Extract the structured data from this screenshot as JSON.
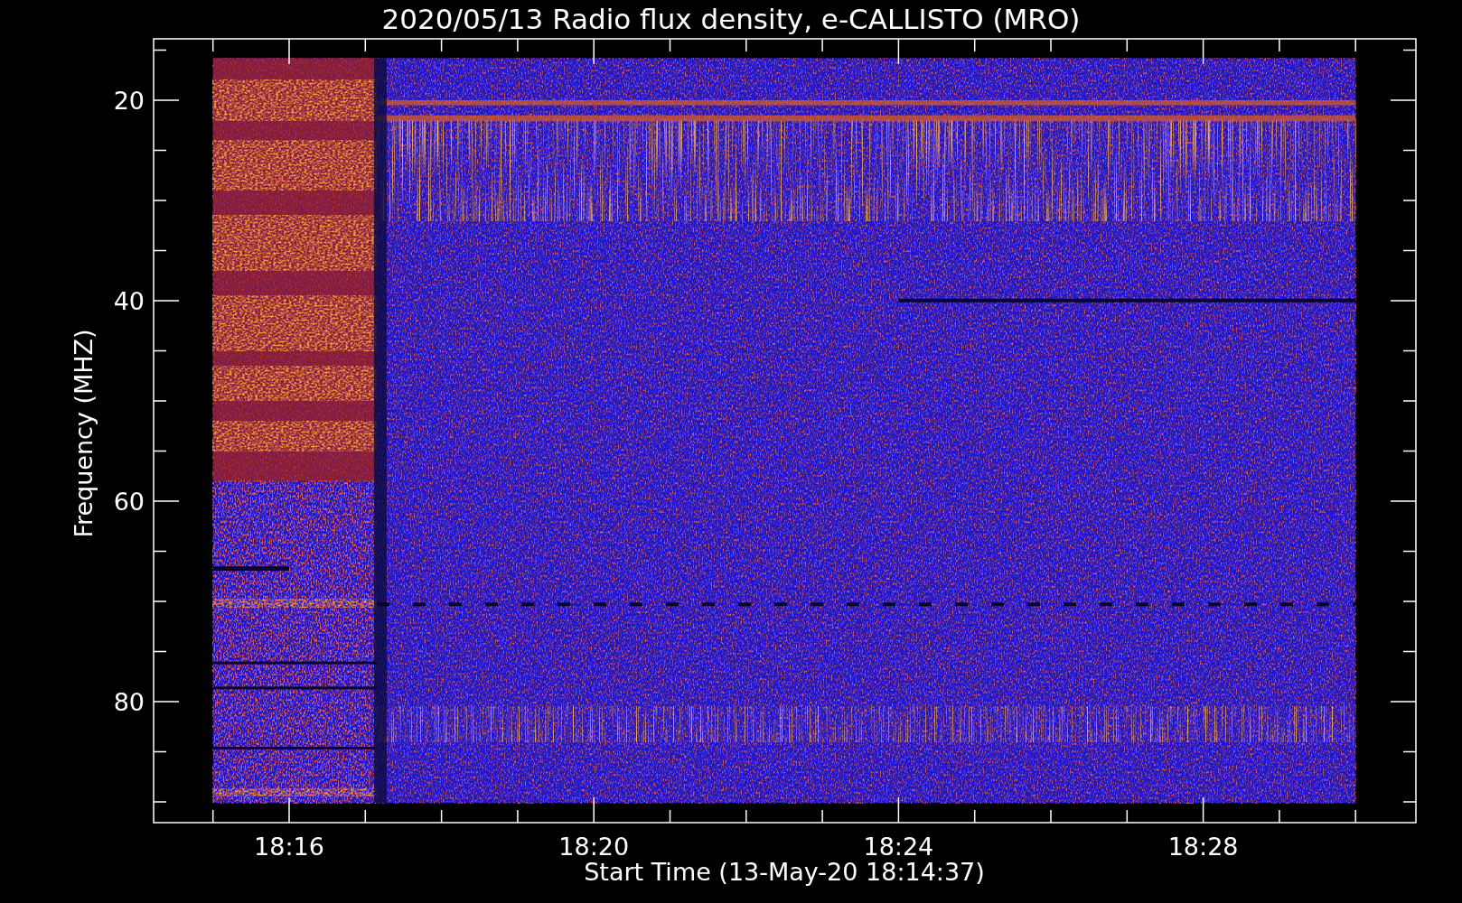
{
  "plot": {
    "title": "2020/05/13  Radio flux density, e-CALLISTO (MRO)",
    "ylabel": "Frequency (MHZ)",
    "xlabel": "Start Time (13-May-20 18:14:37)",
    "xtick_labels": [
      "18:16",
      "18:20",
      "18:24",
      "18:28"
    ],
    "ytick_labels": [
      "20",
      "40",
      "60",
      "80"
    ]
  }
}
